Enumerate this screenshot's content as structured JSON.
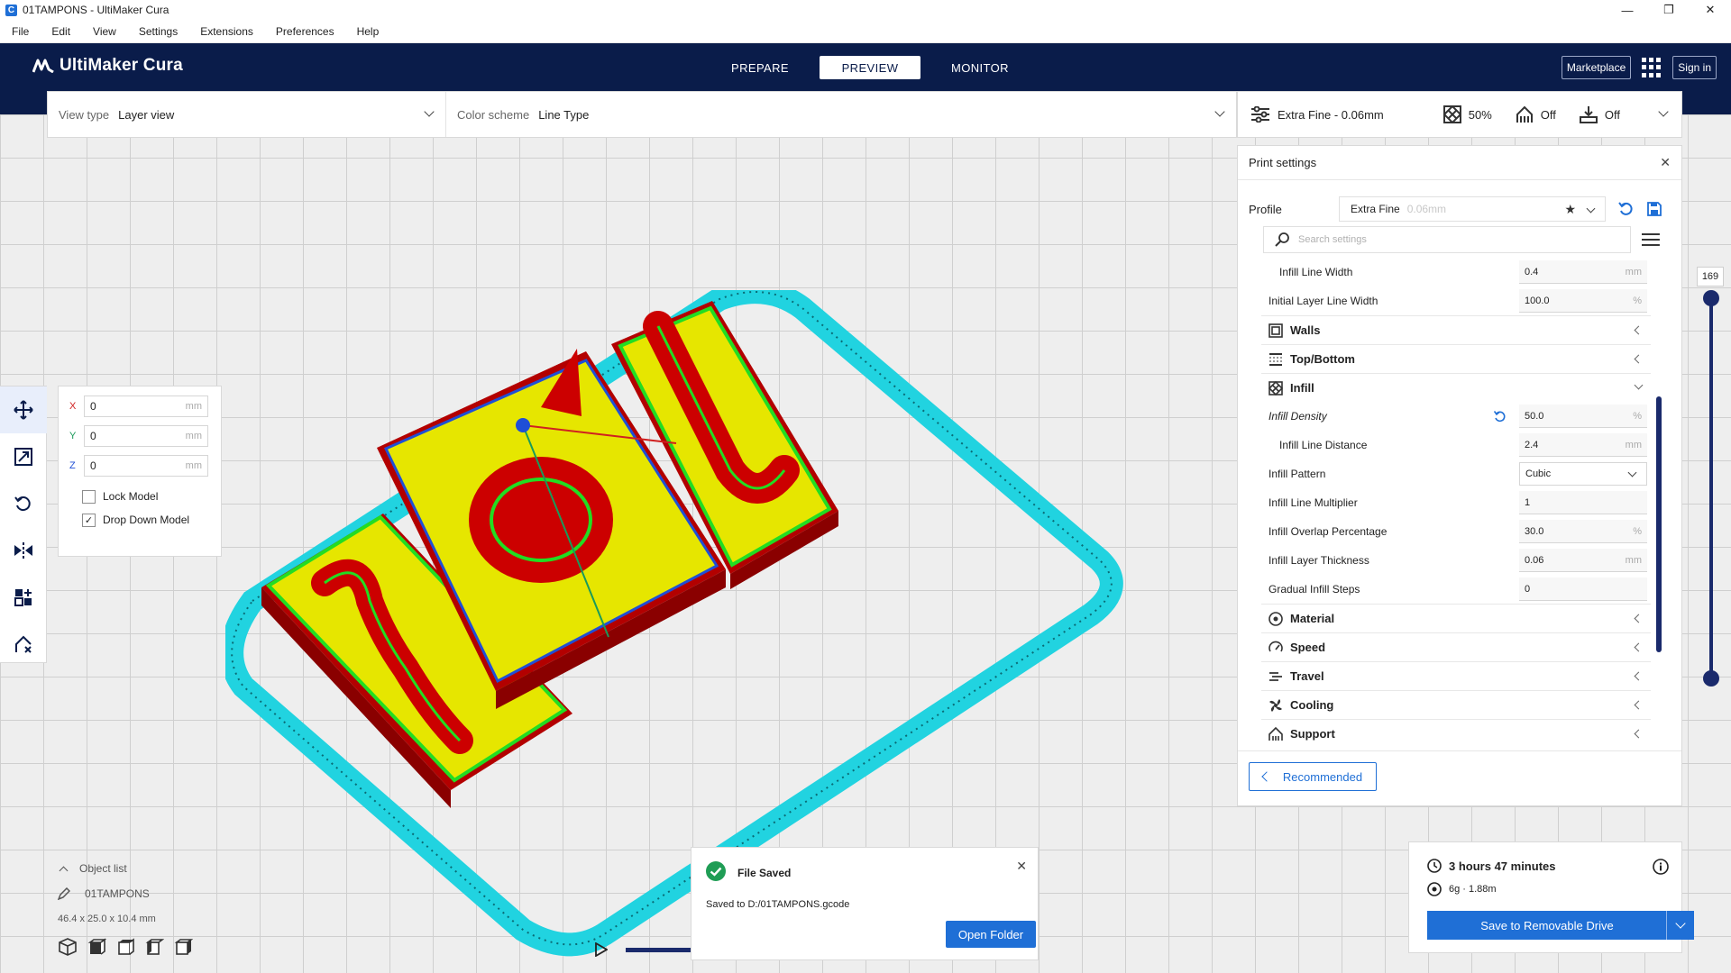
{
  "window": {
    "title": "01TAMPONS - UltiMaker Cura",
    "app_icon_letter": "C",
    "controls": [
      "—",
      "❐",
      "✕"
    ]
  },
  "menu": [
    "File",
    "Edit",
    "View",
    "Settings",
    "Extensions",
    "Preferences",
    "Help"
  ],
  "header": {
    "brand": "UltiMaker Cura",
    "stages": [
      "PREPARE",
      "PREVIEW",
      "MONITOR"
    ],
    "active_stage": "PREVIEW",
    "marketplace": "Marketplace",
    "sign_in": "Sign in"
  },
  "viewbar": {
    "view_type_label": "View type",
    "view_type_value": "Layer view",
    "color_scheme_label": "Color scheme",
    "color_scheme_value": "Line Type"
  },
  "setup_summary": {
    "profile": "Extra Fine - 0.06mm",
    "infill": "50%",
    "support": "Off",
    "adhesion": "Off"
  },
  "move_panel": {
    "x_label": "X",
    "x_value": "0",
    "y_label": "Y",
    "y_value": "0",
    "z_label": "Z",
    "z_value": "0",
    "unit": "mm",
    "lock_model": "Lock Model",
    "lock_model_checked": false,
    "drop_down_model": "Drop Down Model",
    "drop_down_model_checked": true
  },
  "object_list": {
    "title": "Object list",
    "object_name": "01TAMPONS",
    "dimensions": "46.4 x 25.0 x 10.4 mm"
  },
  "print_settings": {
    "title": "Print settings",
    "profile_label": "Profile",
    "profile_name": "Extra Fine",
    "profile_sub": "0.06mm",
    "search_placeholder": "Search settings",
    "rows": [
      {
        "name": "Infill Line Width",
        "value": "0.4",
        "unit": "mm",
        "indent": true
      },
      {
        "name": "Initial Layer Line Width",
        "value": "100.0",
        "unit": "%",
        "indent": false
      }
    ],
    "categories_before": [
      "Walls",
      "Top/Bottom"
    ],
    "infill_category": "Infill",
    "infill_rows": [
      {
        "name": "Infill Density",
        "value": "50.0",
        "unit": "%",
        "italic": true
      },
      {
        "name": "Infill Line Distance",
        "value": "2.4",
        "unit": "mm",
        "indent": true
      },
      {
        "name": "Infill Pattern",
        "value": "Cubic",
        "unit": ""
      },
      {
        "name": "Infill Line Multiplier",
        "value": "1",
        "unit": ""
      },
      {
        "name": "Infill Overlap Percentage",
        "value": "30.0",
        "unit": "%"
      },
      {
        "name": "Infill Layer Thickness",
        "value": "0.06",
        "unit": "mm"
      },
      {
        "name": "Gradual Infill Steps",
        "value": "0",
        "unit": ""
      }
    ],
    "categories_after": [
      "Material",
      "Speed",
      "Travel",
      "Cooling",
      "Support"
    ],
    "recommended": "Recommended"
  },
  "layer_slider": {
    "current_layer": "169"
  },
  "notification": {
    "title": "File Saved",
    "message": "Saved to D:/01TAMPONS.gcode",
    "button": "Open Folder"
  },
  "action_panel": {
    "print_time": "3 hours 47 minutes",
    "material": "6g · 1.88m",
    "save_button": "Save to Removable Drive"
  },
  "colors": {
    "header_bg": "#0a1c4a",
    "accent_blue": "#1f6fd6",
    "skirt_cyan": "#21d3e0",
    "wall_red": "#cc0000",
    "infill_yellow": "#e6e600",
    "inner_wall_green": "#22dd22"
  }
}
